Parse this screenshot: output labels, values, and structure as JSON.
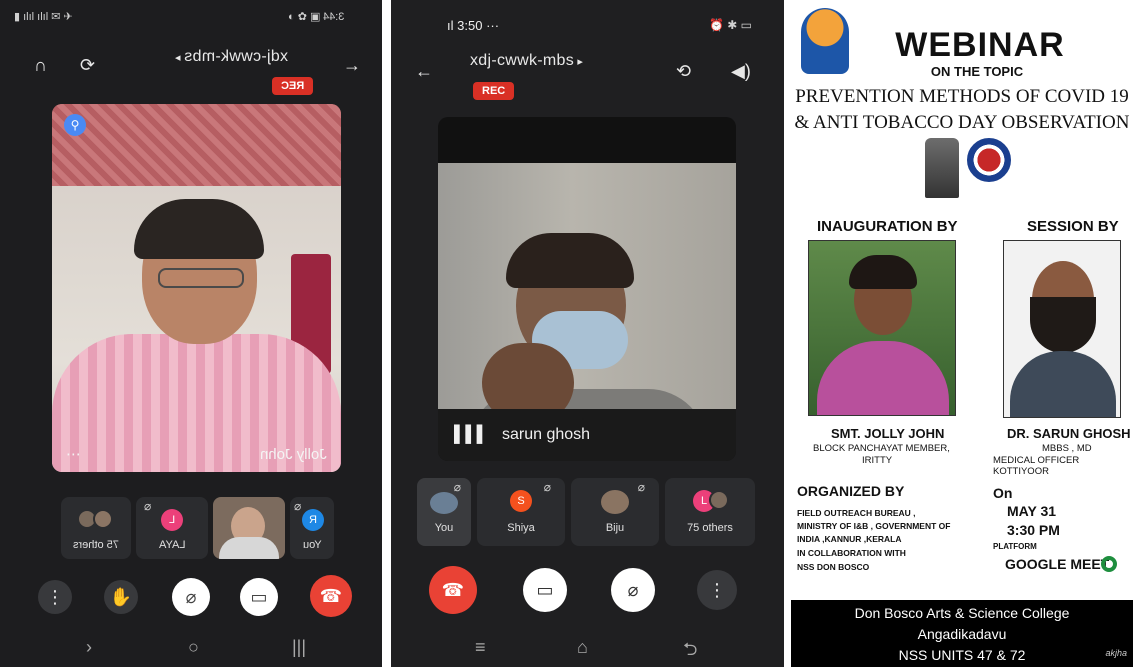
{
  "phone1": {
    "status_time": "3:44",
    "meeting_code": "xdj-cwwk-mbs",
    "rec": "REC",
    "participant_name": "Jolly John",
    "more": "⋯",
    "tiles": [
      {
        "label": "75 others"
      },
      {
        "label": "LAYA",
        "initial": "L"
      },
      {
        "label": ""
      },
      {
        "label": "You",
        "initial": "R"
      }
    ]
  },
  "phone2": {
    "status_time": "3:50",
    "status_dots": "···",
    "meeting_code": "xdj-cwwk-mbs",
    "rec": "REC",
    "participant_name": "sarun ghosh",
    "tiles": [
      {
        "label": "You"
      },
      {
        "label": "Shiya",
        "initial": "S"
      },
      {
        "label": "Biju"
      },
      {
        "label": "75 others",
        "initial": "L"
      }
    ]
  },
  "poster": {
    "heading": "WEBINAR",
    "on_topic": "ON THE TOPIC",
    "topic_line1": "PREVENTION METHODS OF COVID 19",
    "topic_line2": "& ANTI TOBACCO DAY OBSERVATION",
    "inauguration_label": "INAUGURATION BY",
    "session_label": "SESSION BY",
    "inaugurator_name": "SMT. JOLLY JOHN",
    "inaugurator_role1": "BLOCK PANCHAYAT MEMBER,",
    "inaugurator_role2": "IRITTY",
    "speaker_name": "DR. SARUN GHOSH",
    "speaker_degree": "MBBS , MD",
    "speaker_role": "MEDICAL OFFICER KOTTIYOOR",
    "organized_label": "ORGANIZED BY",
    "org_line1": "FIELD OUTREACH BUREAU ,",
    "org_line2": "MINISTRY OF I&B , GOVERNMENT OF",
    "org_line3": "INDIA ,KANNUR ,KERALA",
    "org_line4": "IN COLLABORATION WITH",
    "org_line5": "NSS DON BOSCO",
    "on_label": "On",
    "date": "MAY 31",
    "time": "3:30 PM",
    "platform_label": "PLATFORM",
    "platform": "GOOGLE MEET",
    "footer_line1": "Don Bosco Arts & Science College",
    "footer_line2": "Angadikadavu",
    "footer_line3": "NSS UNITS 47 & 72",
    "credit": "akjha"
  },
  "colors": {
    "end_call": "#e94235",
    "rec": "#d93025",
    "meet_green": "#1e8e3e"
  }
}
